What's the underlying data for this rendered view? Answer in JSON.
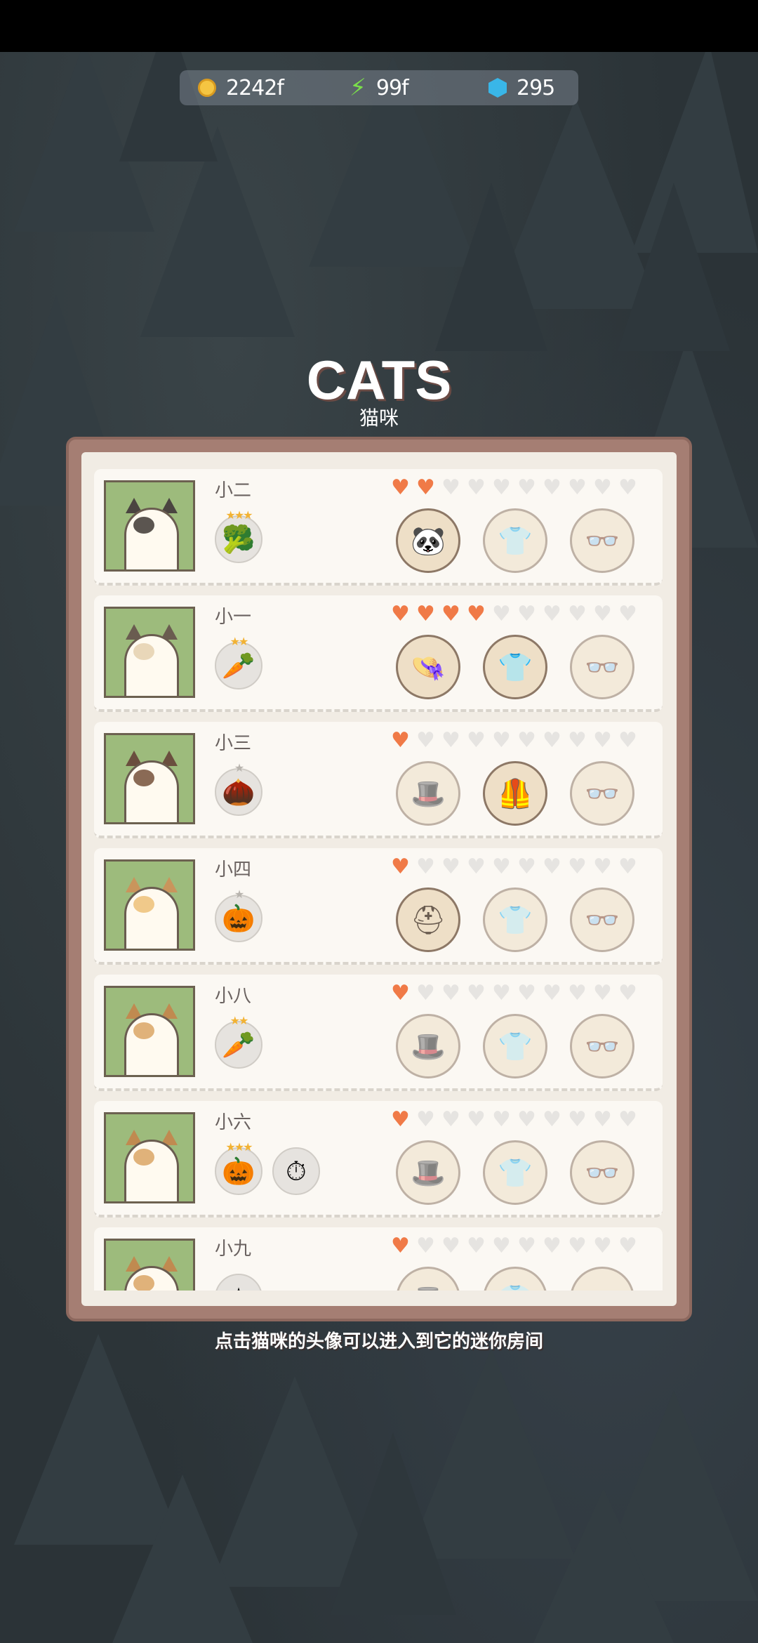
{
  "currency": {
    "coins": "2242f",
    "energy": "99f",
    "gems": "295"
  },
  "header": {
    "title": "CATS",
    "subtitle": "猫咪"
  },
  "hint": "点击猫咪的头像可以进入到它的迷你房间",
  "cats": [
    {
      "name": "小二",
      "hearts": 2,
      "badges": [
        {
          "icon": "broccoli",
          "glyph": "🥦",
          "stars": 3
        }
      ],
      "slots": [
        "panda-hat",
        "shirt",
        "glasses"
      ],
      "filled": [
        true,
        false,
        false
      ]
    },
    {
      "name": "小一",
      "hearts": 4,
      "badges": [
        {
          "icon": "carrot",
          "glyph": "🥕",
          "stars": 2
        }
      ],
      "slots": [
        "straw-hat",
        "shirt",
        "glasses"
      ],
      "filled": [
        true,
        true,
        false
      ]
    },
    {
      "name": "小三",
      "hearts": 1,
      "badges": [
        {
          "icon": "acorn",
          "glyph": "🌰",
          "stars": 1
        }
      ],
      "slots": [
        "hat",
        "vest",
        "glasses"
      ],
      "filled": [
        false,
        true,
        false
      ]
    },
    {
      "name": "小四",
      "hearts": 1,
      "badges": [
        {
          "icon": "pumpkin",
          "glyph": "🎃",
          "stars": 1
        }
      ],
      "slots": [
        "hard-hat",
        "shirt",
        "glasses"
      ],
      "filled": [
        true,
        false,
        false
      ]
    },
    {
      "name": "小八",
      "hearts": 1,
      "badges": [
        {
          "icon": "carrot",
          "glyph": "🥕",
          "stars": 2
        }
      ],
      "slots": [
        "hat",
        "shirt",
        "glasses"
      ],
      "filled": [
        false,
        false,
        false
      ]
    },
    {
      "name": "小六",
      "hearts": 1,
      "badges": [
        {
          "icon": "pumpkin",
          "glyph": "🎃",
          "stars": 3
        },
        {
          "icon": "pocket-watch",
          "glyph": "⏱",
          "stars": 0
        }
      ],
      "slots": [
        "hat",
        "shirt",
        "glasses"
      ],
      "filled": [
        false,
        false,
        false
      ]
    },
    {
      "name": "小九",
      "hearts": 1,
      "badges": [
        {
          "icon": "item",
          "glyph": "☆",
          "stars": 0
        }
      ],
      "slots": [
        "hat",
        "shirt",
        "glasses"
      ],
      "filled": [
        false,
        false,
        false
      ]
    }
  ],
  "colors": {
    "heart_on": "#f07a47",
    "avatar_bg": "#9dbb7c",
    "panel": "#a57e73"
  }
}
